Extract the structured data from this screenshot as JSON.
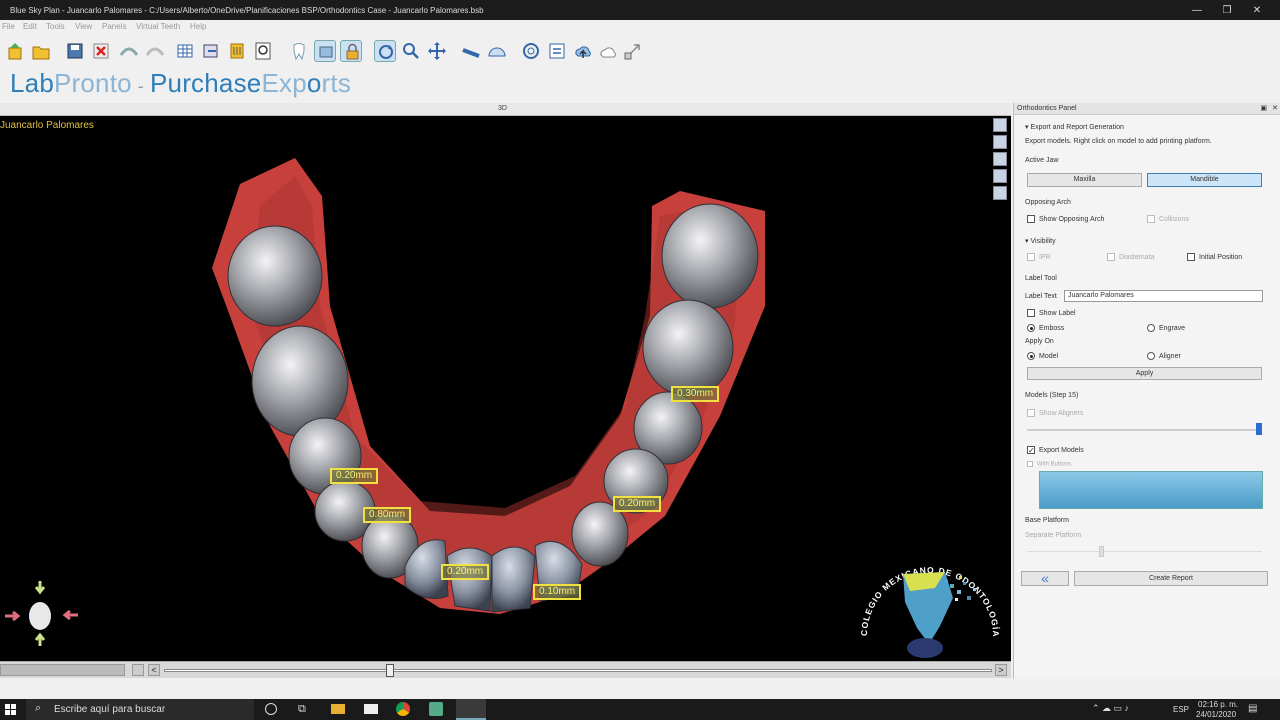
{
  "window": {
    "title": "Blue Sky Plan - Juancarlo Palomares - C:/Users/Alberto/OneDrive/Planificaciones BSP/Orthodontics Case - Juancarlo Palomares.bsb",
    "minimize": "—",
    "restore": "❐",
    "close": "✕"
  },
  "menu": [
    "File",
    "Edit",
    "Tools",
    "View",
    "Panels",
    "Virtual Teeth",
    "Help"
  ],
  "brand": {
    "lab": "Lab",
    "pronto": "Pronto",
    "sep": "-",
    "purchase": "Purchase",
    "exports": "Exp",
    "o": "o",
    "rts": "rts"
  },
  "viewport": {
    "tab": "3D",
    "patient": "Juancarlo Palomares",
    "labels": [
      "0.30mm",
      "0.20mm",
      "0.80mm",
      "0.20mm",
      "0.20mm",
      "0.10mm"
    ],
    "logo_text": "COLEGIO MEXICANO DE ODONTOLOGÍA DIGITAL A.C."
  },
  "panel": {
    "title": "Orthodontics Panel",
    "section": "Export and Report Generation",
    "desc": "Export models. Right click on model to add printing platform.",
    "active_jaw_label": "Active Jaw",
    "jaw_maxilla": "Maxilla",
    "jaw_mandible": "Mandible",
    "opposing_label": "Opposing Arch",
    "show_opposing": "Show Opposing Arch",
    "collisions": "Collisions",
    "visibility": "Visibility",
    "ipr": "IPR",
    "diastemata": "Diastemata",
    "initial_position": "Initial Position",
    "label_tool": "Label Tool",
    "label_text_label": "Label Text",
    "label_text_value": "Juancarlo Palomares",
    "show_label": "Show Label",
    "emboss": "Emboss",
    "engrave": "Engrave",
    "apply_on": "Apply On",
    "model": "Model",
    "aligner": "Aligner",
    "apply": "Apply",
    "models_step": "Models (Step 15)",
    "show_aligners": "Show Aligners",
    "slider_fraction": 1.0,
    "export_models": "Export Models",
    "with_buttons": "With Buttons",
    "base_platform": "Base Platform",
    "separate_platform": "Separate Platform",
    "create_report": "Create Report",
    "back_icon": "«"
  },
  "taskbar": {
    "search_placeholder": "Escribe aquí para buscar",
    "lang": "ESP",
    "time": "02:16 p. m.",
    "date": "24/01/2020"
  },
  "colors": {
    "accent": "#2e7fb8",
    "label_border": "#f0e040",
    "gum": "#c8403c"
  }
}
